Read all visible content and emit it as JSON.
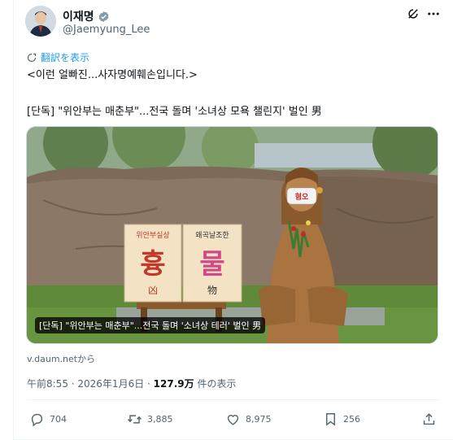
{
  "author": {
    "display_name": "이재명",
    "handle": "@Jaemyung_Lee",
    "verified_icon": "verified-badge-icon",
    "verified_color": "#829aab"
  },
  "header": {
    "grok_icon": "grok-icon",
    "more_icon": "more-options-icon"
  },
  "translate": {
    "label": "翻訳を表示",
    "color": "#1d9bf0"
  },
  "tweet": {
    "line1": "<이런 얼빠진...사자명예훼손입니다.>",
    "line2": "[단독] \"위안부는 매춘부\"...전국 돌며 '소녀상 모욕 챌린지' 벌인 男"
  },
  "card": {
    "caption": "[단독] \"위안부는 매춘부\"...전국 돌며 '소녀상 테러' 벌인 男",
    "sign_left_top": "위안부실상",
    "sign_left_main": "흉",
    "sign_left_hanja": "凶",
    "sign_right_top": "왜곡날조한",
    "sign_right_main": "물",
    "sign_right_hanja": "物",
    "mask_text": "혐오",
    "source": "v.daum.netから"
  },
  "meta": {
    "time_date": "午前8:55 · 2026年1月6日 · ",
    "views": "127.9万",
    "views_suffix": " 件の表示"
  },
  "actions": {
    "replies": "704",
    "retweets": "3,885",
    "likes": "8,975",
    "bookmarks": "256",
    "share_icon": "share-icon"
  }
}
